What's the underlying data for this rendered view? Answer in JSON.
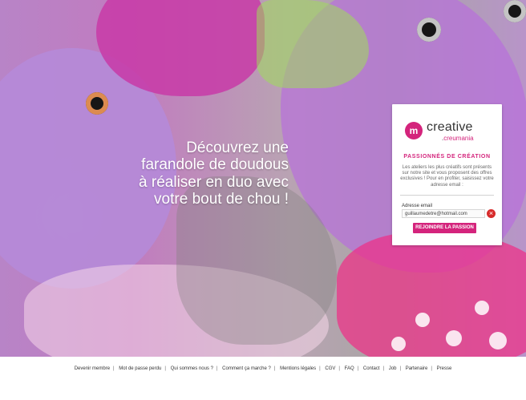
{
  "hero": {
    "headline_lines": [
      "Découvrez une",
      "farandole de doudous",
      "à réaliser en duo avec",
      "votre bout de chou !"
    ]
  },
  "card": {
    "logo": {
      "main": "creative",
      "sub_prefix": ".",
      "sub_brand": "creumania"
    },
    "title": "PASSIONNÉS DE CRÉATION",
    "description": "Les ateliers les plus créatifs sont présents sur notre site et vous proposent des offres exclusives ! Pour en profiter, saisissez votre adresse email :",
    "email_label": "Adresse email",
    "email_value": "guillaumedetre@hotmail.com",
    "cta_label": "REJOINDRE LA PASSION",
    "colors": {
      "accent": "#d4247c"
    }
  },
  "footer": {
    "links": [
      "Devenir membre",
      "Mot de passe perdu",
      "Qui sommes nous ?",
      "Comment ça marche ?",
      "Mentions légales",
      "CGV",
      "FAQ",
      "Contact",
      "Job",
      "Partenaire",
      "Presse"
    ]
  }
}
